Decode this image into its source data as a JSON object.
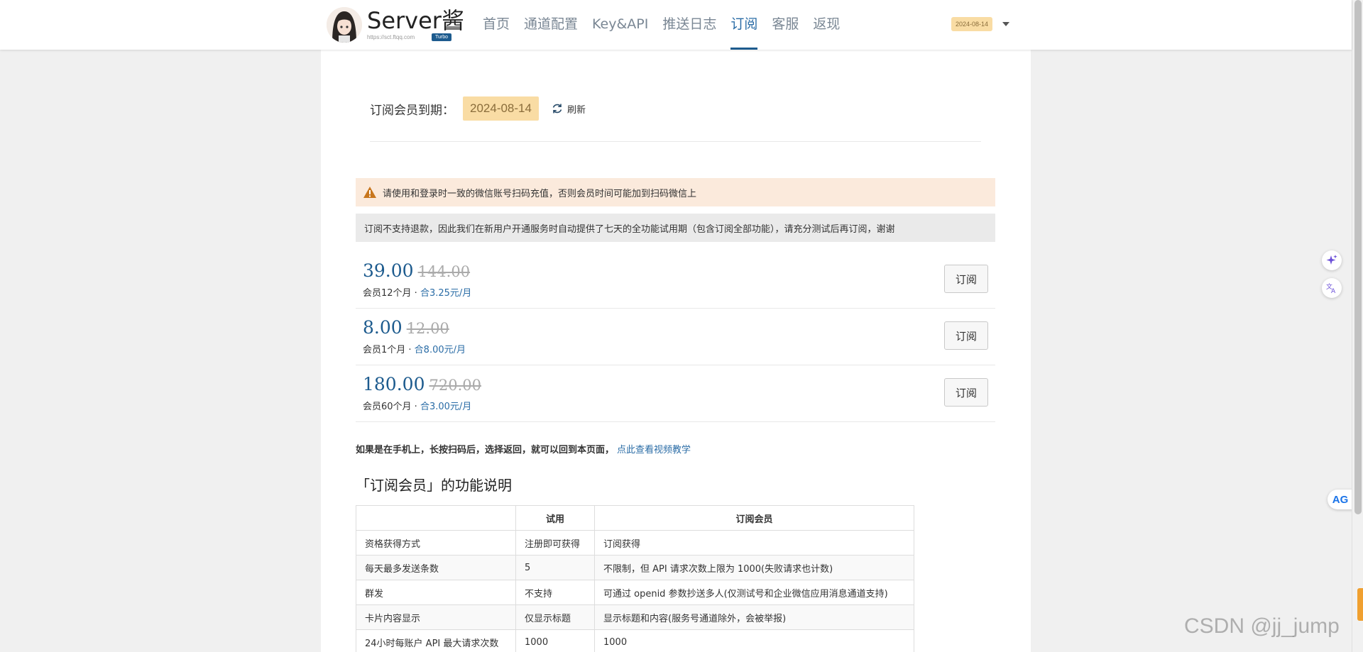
{
  "header": {
    "logo_title": "Server酱",
    "logo_url": "https://sct.ftqq.com",
    "logo_badge": "Turbo",
    "nav": [
      "首页",
      "通道配置",
      "Key&API",
      "推送日志",
      "订阅",
      "客服",
      "返现"
    ],
    "active_nav": "订阅",
    "user_date": "2024-08-14"
  },
  "subscription": {
    "expire_label": "订阅会员到期：",
    "expire_date": "2024-08-14",
    "refresh_label": "刷新"
  },
  "alerts": {
    "warning": "请使用和登录时一致的微信账号扫码充值，否则会员时间可能加到扫码微信上",
    "info": "订阅不支持退款，因此我们在新用户开通服务时自动提供了七天的全功能试用期（包含订阅全部功能），请充分测试后再订阅，谢谢"
  },
  "plans": [
    {
      "price": "39.00",
      "original": "144.00",
      "desc": "会员12个月 · ",
      "per": "合3.25元/月",
      "button": "订阅"
    },
    {
      "price": "8.00",
      "original": "12.00",
      "desc": "会员1个月 · ",
      "per": "合8.00元/月",
      "button": "订阅"
    },
    {
      "price": "180.00",
      "original": "720.00",
      "desc": "会员60个月 · ",
      "per": "合3.00元/月",
      "button": "订阅"
    }
  ],
  "mobile_tip": {
    "text": "如果是在手机上，长按扫码后，选择返回，就可以回到本页面，",
    "link": "点此查看视频教学"
  },
  "features": {
    "title": "「订阅会员」的功能说明",
    "headers": [
      "",
      "试用",
      "订阅会员"
    ],
    "rows": [
      [
        "资格获得方式",
        "注册即可获得",
        "订阅获得"
      ],
      [
        "每天最多发送条数",
        "5",
        "不限制，但 API 请求次数上限为 1000(失败请求也计数)"
      ],
      [
        "群发",
        "不支持",
        "可通过 openid 参数抄送多人(仅测试号和企业微信应用消息通道支持)"
      ],
      [
        "卡片内容显示",
        "仅显示标题",
        "显示标题和内容(服务号通道除外，会被举报)"
      ],
      [
        "24小时每账户 API 最大请求次数",
        "1000",
        "1000"
      ]
    ]
  },
  "widgets": {
    "ag_label": "AG",
    "watermark": "CSDN @jj_jump"
  },
  "colors": {
    "brand": "#1d5b8e",
    "accent_link": "#2a6ca6",
    "date_badge_bg": "#f9dca4",
    "warning_bg": "#fbeadc",
    "warning_icon": "#c8761d"
  }
}
